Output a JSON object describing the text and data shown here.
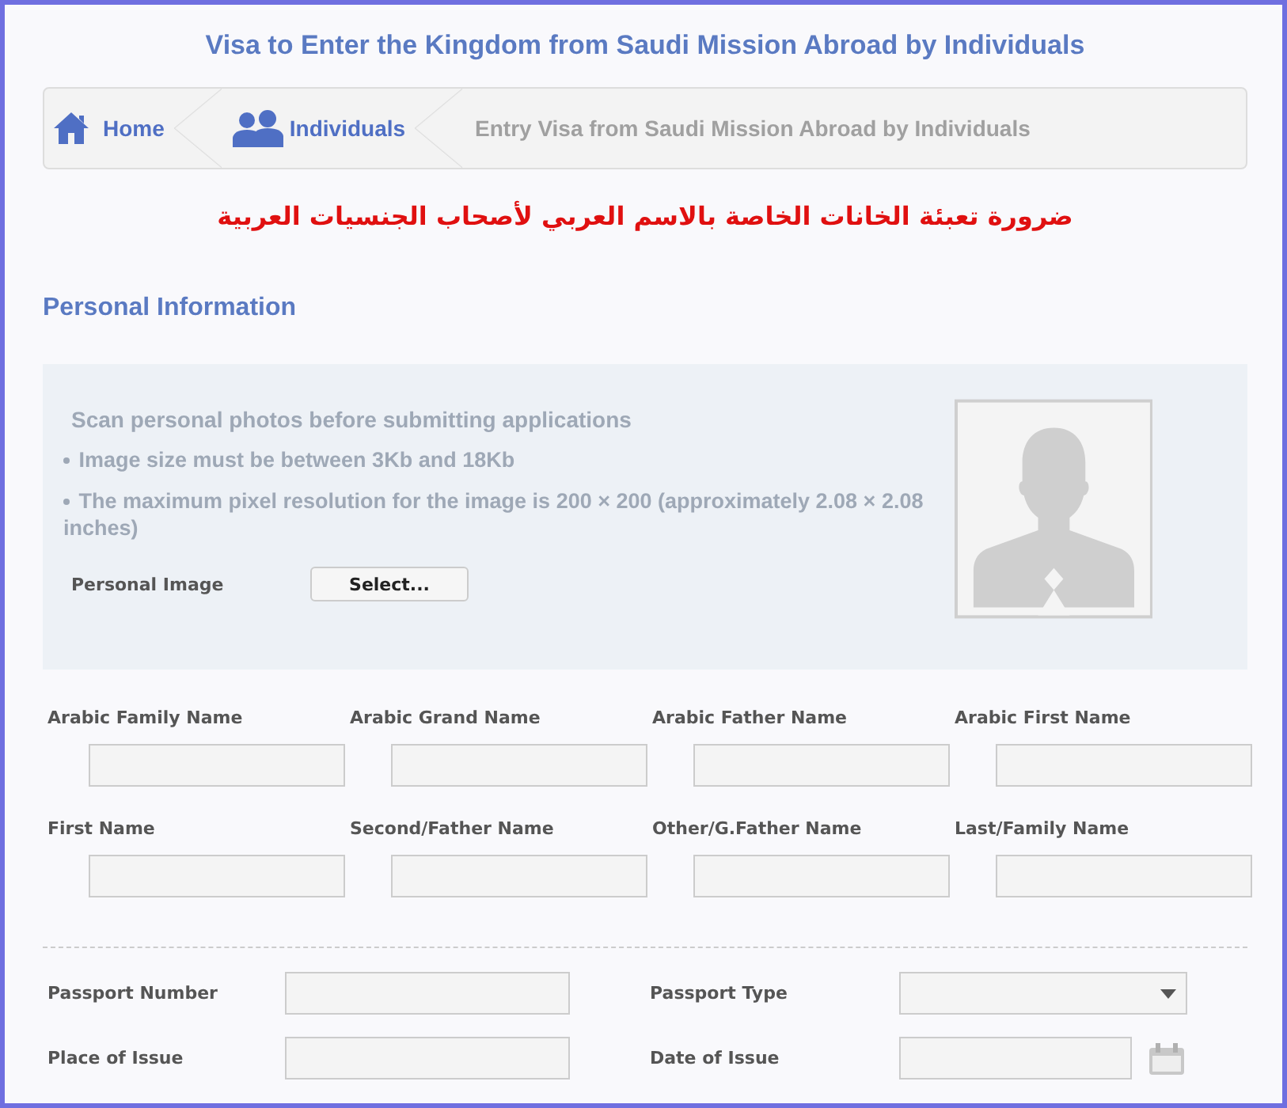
{
  "title": "Visa to Enter the Kingdom from Saudi Mission Abroad by Individuals",
  "breadcrumb": [
    {
      "label": "Home",
      "kind": "home"
    },
    {
      "label": "Individuals",
      "kind": "people"
    },
    {
      "label": "Entry Visa from Saudi Mission Abroad by Individuals",
      "kind": "current"
    }
  ],
  "notice": "ضرورة تعبئة الخانات الخاصة بالاسم العربي لأصحاب الجنسيات العربية",
  "section_title": "Personal Information",
  "photo_panel": {
    "heading": "Scan personal photos before submitting applications",
    "bullets": [
      "Image size must be between 3Kb and 18Kb",
      "The maximum pixel resolution for the image is 200 × 200 (approximately 2.08 × 2.08 inches)"
    ],
    "image_label": "Personal Image",
    "select_button": "Select..."
  },
  "name_rows": [
    [
      "Arabic Family Name",
      "Arabic Grand Name",
      "Arabic Father Name",
      "Arabic First Name"
    ],
    [
      "First Name",
      "Second/Father Name",
      "Other/G.Father Name",
      "Last/Family Name"
    ]
  ],
  "passport_rows": [
    [
      {
        "label": "Passport Number",
        "kind": "text"
      },
      {
        "label": "Passport Type",
        "kind": "select"
      }
    ],
    [
      {
        "label": "Place of Issue",
        "kind": "text"
      },
      {
        "label": "Date of Issue",
        "kind": "date"
      }
    ]
  ]
}
